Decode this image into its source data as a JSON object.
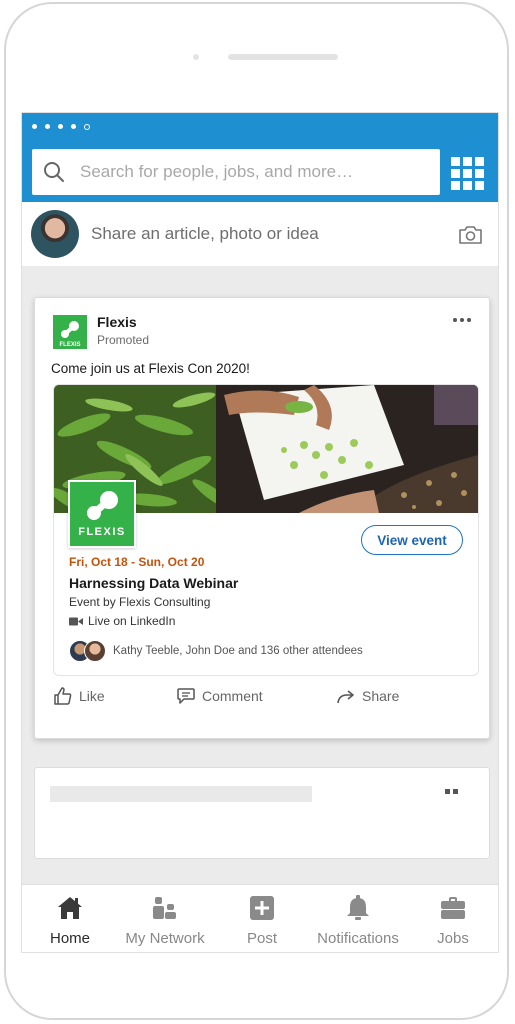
{
  "search": {
    "placeholder": "Search for people, jobs, and more…"
  },
  "share": {
    "prompt": "Share an article, photo or idea"
  },
  "post": {
    "brand": "Flexis",
    "promoted_label": "Promoted",
    "text": "Come join us at Flexis Con 2020!",
    "logo_small_word": "FLEXIS",
    "event": {
      "logo_word": "FLEXIS",
      "date": "Fri, Oct 18 - Sun, Oct 20",
      "title": "Harnessing Data Webinar",
      "organizer": "Event by Flexis Consulting",
      "live": "Live on LinkedIn",
      "attendees": "Kathy Teeble, John Doe and 136 other attendees",
      "cta": "View event"
    },
    "actions": {
      "like": "Like",
      "comment": "Comment",
      "share": "Share"
    }
  },
  "tabs": [
    {
      "label": "Home",
      "icon": "home-icon",
      "active": true
    },
    {
      "label": "My Network",
      "icon": "network-icon",
      "active": false
    },
    {
      "label": "Post",
      "icon": "plus-square-icon",
      "active": false
    },
    {
      "label": "Notifications",
      "icon": "bell-icon",
      "active": false
    },
    {
      "label": "Jobs",
      "icon": "briefcase-icon",
      "active": false
    }
  ],
  "colors": {
    "topbar": "#1e8fd0",
    "brand_green": "#35b14a",
    "event_date": "#c4520a",
    "cta_blue": "#1e64b4"
  }
}
